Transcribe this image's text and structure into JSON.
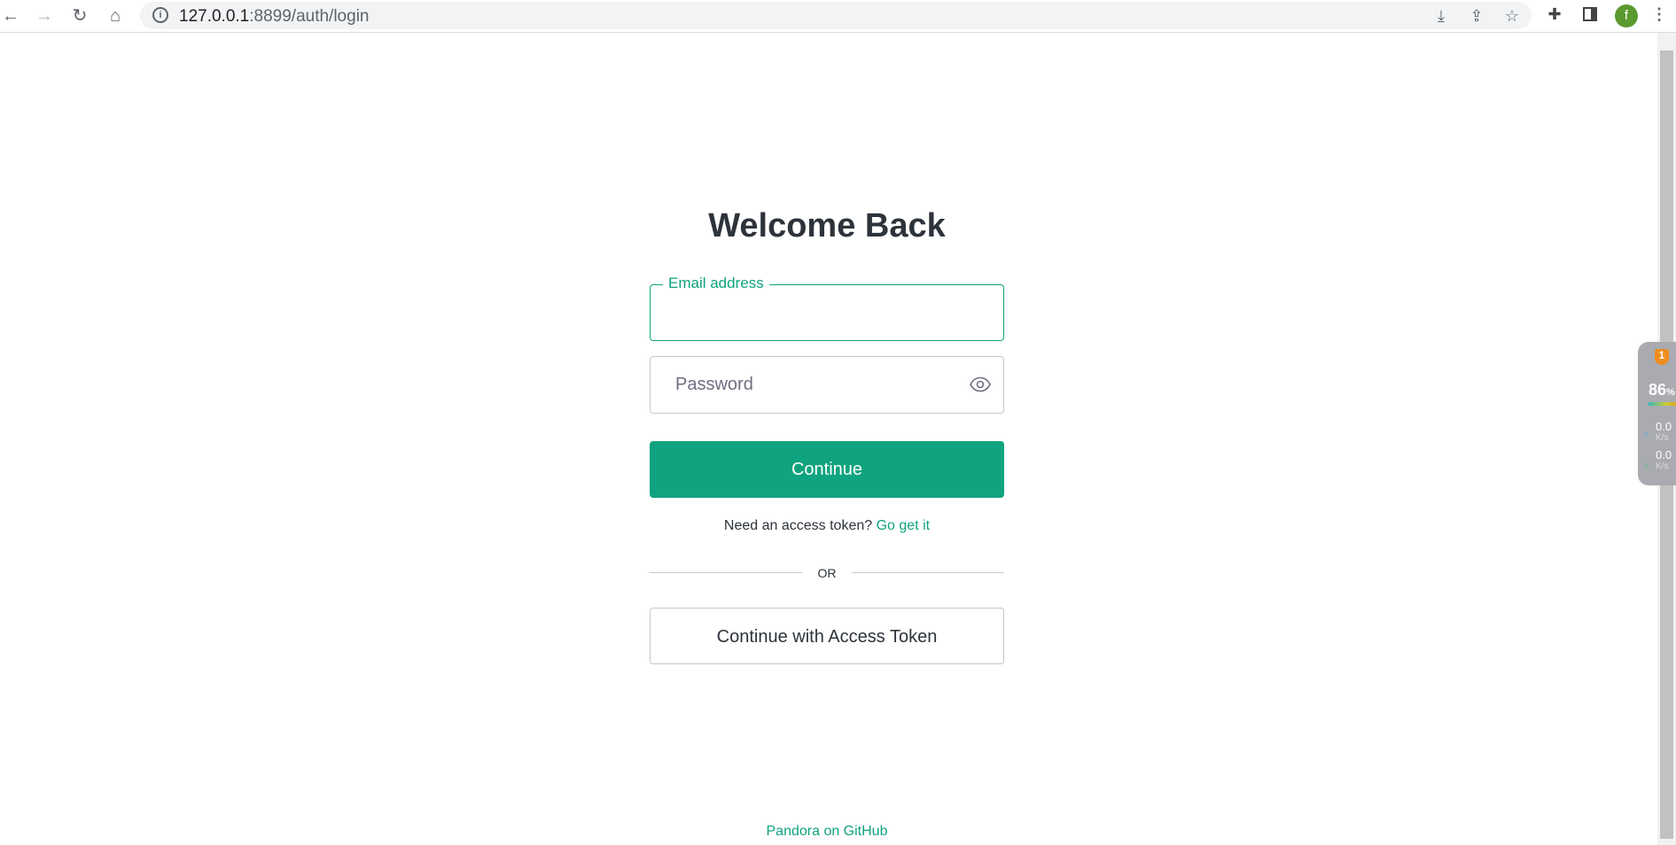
{
  "browser": {
    "url_host": "127.0.0.1",
    "url_rest": ":8899/auth/login",
    "avatar_letter": "f"
  },
  "widget": {
    "badge": "1",
    "percent": "86",
    "percent_unit": "%",
    "up": "0.0",
    "up_unit": "K/s",
    "down": "0.0",
    "down_unit": "K/s"
  },
  "login": {
    "title": "Welcome Back",
    "email_label": "Email address",
    "email_value": "",
    "password_placeholder": "Password",
    "continue_label": "Continue",
    "need_token_text": "Need an access token?",
    "get_it_link": "Go get it",
    "or_text": "OR",
    "access_token_label": "Continue with Access Token"
  },
  "footer": {
    "link": "Pandora on GitHub"
  },
  "colors": {
    "accent": "#10a37f",
    "text": "#2d333a"
  }
}
